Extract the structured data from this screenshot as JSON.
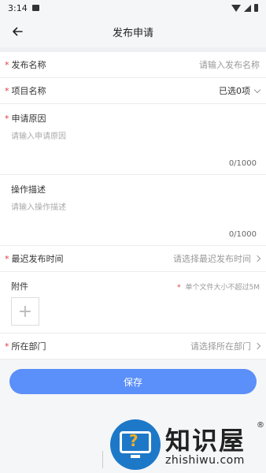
{
  "status": {
    "time": "3:14"
  },
  "header": {
    "title": "发布申请"
  },
  "form": {
    "publish_name": {
      "label": "发布名称",
      "placeholder": "请输入发布名称"
    },
    "project_name": {
      "label": "项目名称",
      "value": "已选0项"
    },
    "apply_reason": {
      "label": "申请原因",
      "placeholder": "请输入申请原因",
      "counter": "0/1000"
    },
    "operation_desc": {
      "label": "操作描述",
      "placeholder": "请输入操作描述",
      "counter": "0/1000"
    },
    "latest_time": {
      "label": "最迟发布时间",
      "placeholder": "请选择最迟发布时间"
    },
    "attachment": {
      "label": "附件",
      "hint": "单个文件大小不超过5M",
      "add_symbol": "+"
    },
    "department": {
      "label": "所在部门",
      "placeholder": "请选择所在部门"
    },
    "required_mark": "*"
  },
  "footer": {
    "save_label": "保存"
  },
  "watermark": {
    "brand": "知识屋",
    "url": "zhishiwu.com",
    "reg": "®",
    "q": "?"
  },
  "colors": {
    "accent": "#5b8ff9",
    "required": "#e23b3b",
    "watermark": "#1e78c8"
  }
}
